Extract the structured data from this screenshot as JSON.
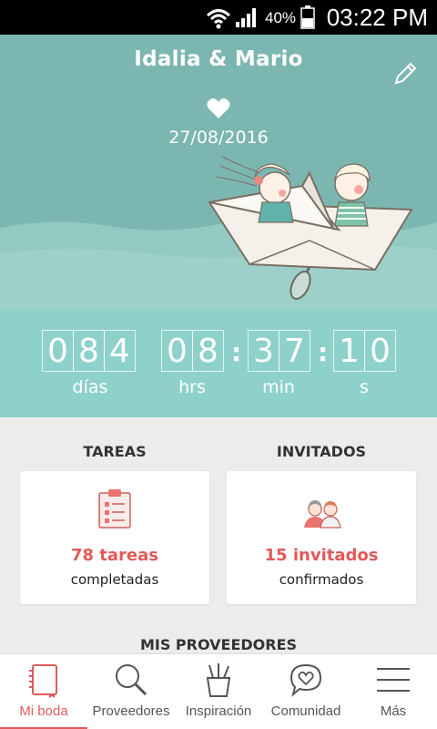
{
  "status_bar": {
    "battery_percent": "40%",
    "time": "03:22 PM",
    "icons": [
      "wifi-icon",
      "signal-icon",
      "battery-icon"
    ]
  },
  "hero": {
    "couple_names": "Idalia & Mario",
    "wedding_date": "27/08/2016",
    "icons": [
      "heart-icon",
      "edit-pencil-icon"
    ]
  },
  "countdown": {
    "days": [
      "0",
      "8",
      "4"
    ],
    "hours": [
      "0",
      "8"
    ],
    "minutes": [
      "3",
      "7"
    ],
    "seconds": [
      "1",
      "0"
    ],
    "separator": ":",
    "labels": {
      "days": "días",
      "hours": "hrs",
      "minutes": "min",
      "seconds": "s"
    }
  },
  "tasks": {
    "title": "TAREAS",
    "count": "78 tareas",
    "caption": "completadas",
    "icon": "clipboard-checklist-icon"
  },
  "guests": {
    "title": "INVITADOS",
    "count": "15 invitados",
    "caption": "confirmados",
    "icon": "guests-couple-icon"
  },
  "providers": {
    "title": "MIS PROVEEDORES"
  },
  "bottom_nav": {
    "items": [
      {
        "label": "Mi boda",
        "icon": "notebook-icon",
        "active": true
      },
      {
        "label": "Proveedores",
        "icon": "search-icon",
        "active": false
      },
      {
        "label": "Inspiración",
        "icon": "pencil-cup-icon",
        "active": false
      },
      {
        "label": "Comunidad",
        "icon": "chat-heart-icon",
        "active": false
      },
      {
        "label": "Más",
        "icon": "menu-icon",
        "active": false
      }
    ]
  },
  "colors": {
    "hero_bg": "#7cb6b1",
    "countdown_bg": "#8ed1cb",
    "accent": "#e15a5a",
    "background": "#ececec"
  }
}
